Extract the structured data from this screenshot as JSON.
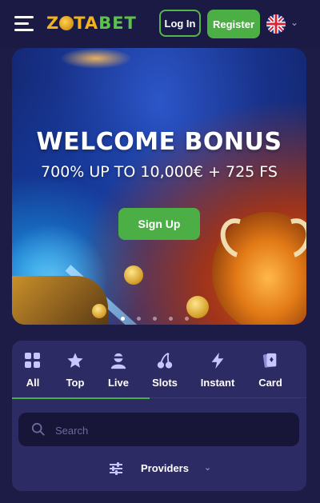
{
  "header": {
    "logo_text": "ZOTABET",
    "logo_part1": "Z",
    "logo_part2": "TA",
    "logo_part3": "BET",
    "login_label": "Log In",
    "register_label": "Register",
    "language_flag": "uk-flag-icon"
  },
  "banner": {
    "title": "WELCOME BONUS",
    "subtitle": "700% UP TO 10,000€ + 725 FS",
    "signup_label": "Sign Up",
    "slides_total": 5,
    "active_slide": 1
  },
  "categories": [
    {
      "label": "All",
      "icon": "grid-icon",
      "active": true
    },
    {
      "label": "Top",
      "icon": "star-icon",
      "active": false
    },
    {
      "label": "Live",
      "icon": "dealer-icon",
      "active": false
    },
    {
      "label": "Slots",
      "icon": "cherry-icon",
      "active": false
    },
    {
      "label": "Instant",
      "icon": "lightning-icon",
      "active": false
    },
    {
      "label": "Card",
      "icon": "playing-card-icon",
      "active": false
    }
  ],
  "search": {
    "placeholder": "Search",
    "value": ""
  },
  "providers": {
    "label": "Providers",
    "icon": "filter-sliders-icon"
  },
  "colors": {
    "background": "#1d1c46",
    "panel": "#2d2b63",
    "accent_green": "#4caf45",
    "logo_gold": "#f1b21b"
  }
}
